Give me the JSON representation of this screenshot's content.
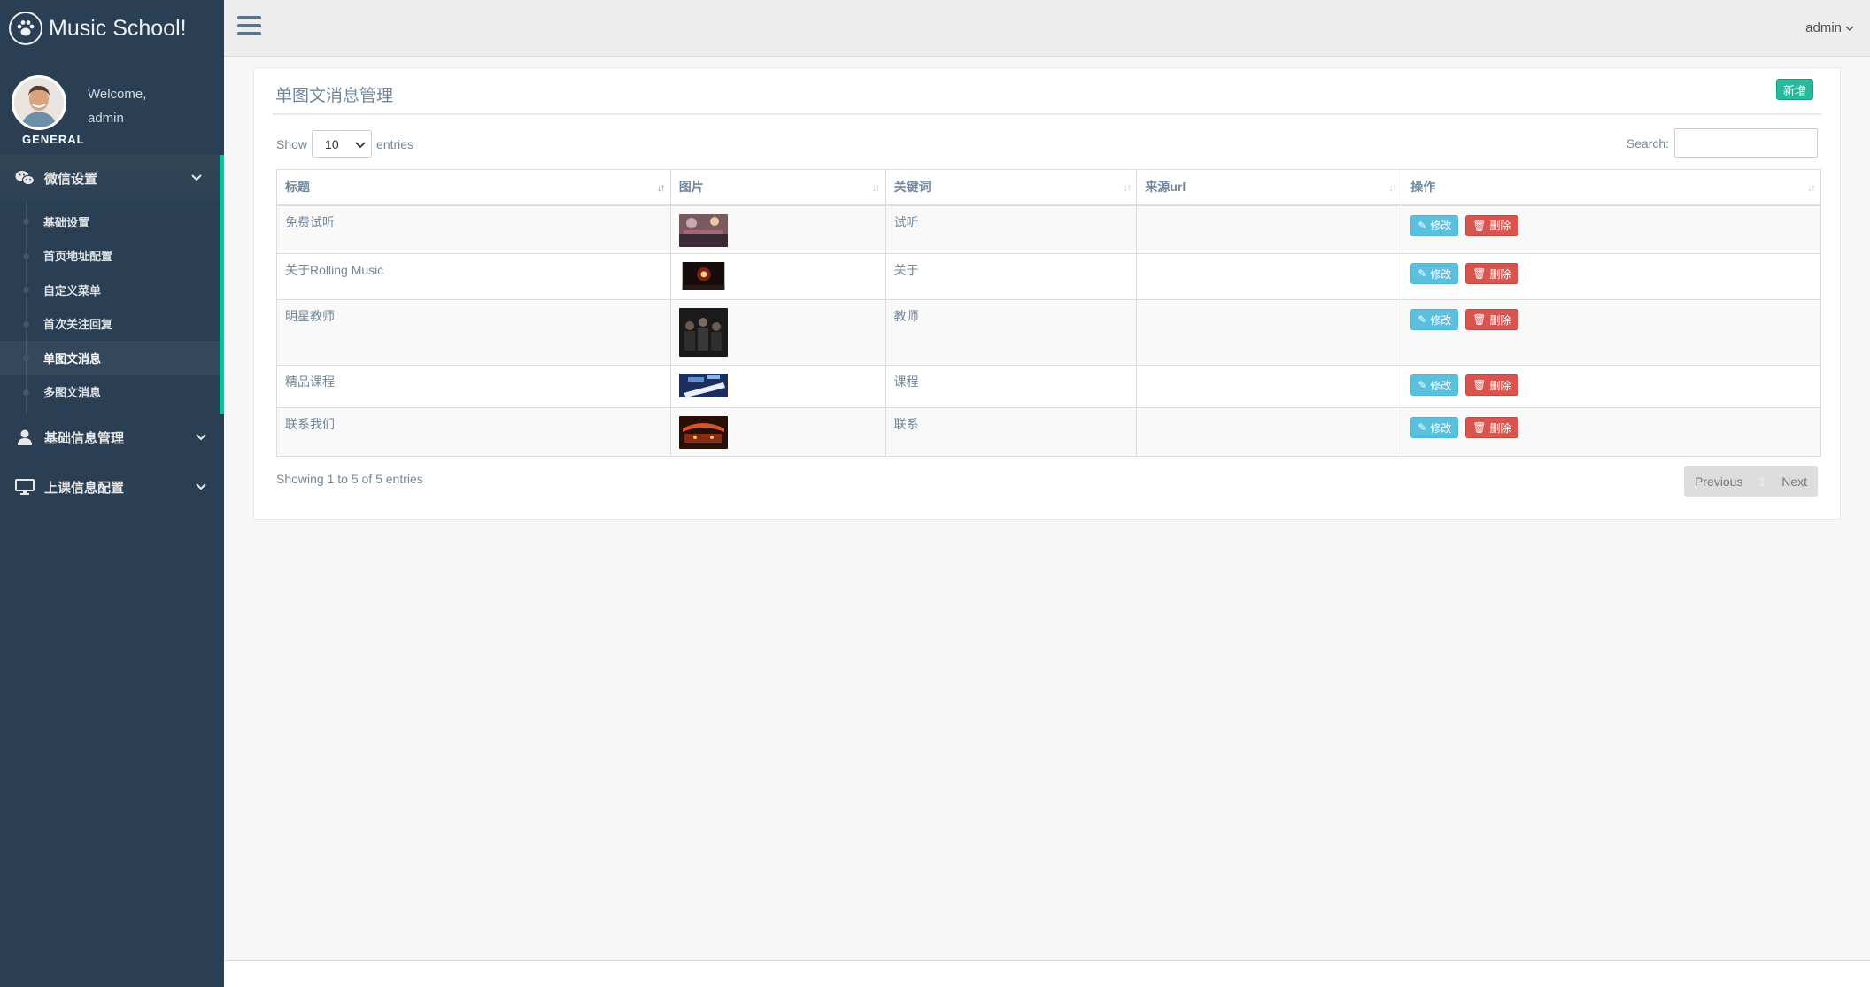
{
  "app": {
    "title": "Music School!",
    "welcome": "Welcome,",
    "username": "admin",
    "section": "GENERAL"
  },
  "colors": {
    "sidebar_bg": "#2A3F54",
    "accent": "#1ABB9C",
    "add_button": "#26B99A",
    "edit_button": "#5BC0DE",
    "delete_button": "#D9534F"
  },
  "icons": {
    "brand": "paw-icon",
    "menu_toggle": "hamburger-icon",
    "wechat": "wechat-icon",
    "user": "user-icon",
    "desktop": "desktop-icon",
    "edit": "pencil-icon",
    "delete": "trash-icon"
  },
  "sidebar": {
    "menus": [
      {
        "label": "微信设置",
        "expanded": true,
        "items": [
          "基础设置",
          "首页地址配置",
          "自定义菜单",
          "首次关注回复",
          "单图文消息",
          "多图文消息"
        ],
        "current_item": "单图文消息"
      },
      {
        "label": "基础信息管理",
        "expanded": false
      },
      {
        "label": "上课信息配置",
        "expanded": false
      }
    ]
  },
  "topnav": {
    "user": "admin"
  },
  "panel": {
    "title": "单图文消息管理",
    "add_label": "新增"
  },
  "table_controls": {
    "show_label": "Show",
    "page_length": "10",
    "entries_label": "entries",
    "search_label": "Search:",
    "search_value": ""
  },
  "table": {
    "headers": [
      "标题",
      "图片",
      "关键词",
      "来源url",
      "操作"
    ],
    "rows": [
      {
        "title": "免费试听",
        "image": "concert-crowd-thumbnail",
        "keyword": "试听",
        "url": ""
      },
      {
        "title": "关于Rolling Music",
        "image": "stage-light-thumbnail",
        "keyword": "关于",
        "url": ""
      },
      {
        "title": "明星教师",
        "image": "band-photo-thumbnail",
        "keyword": "教师",
        "url": ""
      },
      {
        "title": "精品课程",
        "image": "piano-keys-thumbnail",
        "keyword": "课程",
        "url": ""
      },
      {
        "title": "联系我们",
        "image": "stage-show-thumbnail",
        "keyword": "联系",
        "url": ""
      }
    ],
    "edit_label": "修改",
    "delete_label": "删除"
  },
  "pagination": {
    "info": "Showing 1 to 5 of 5 entries",
    "previous": "Previous",
    "current": "1",
    "next": "Next"
  }
}
